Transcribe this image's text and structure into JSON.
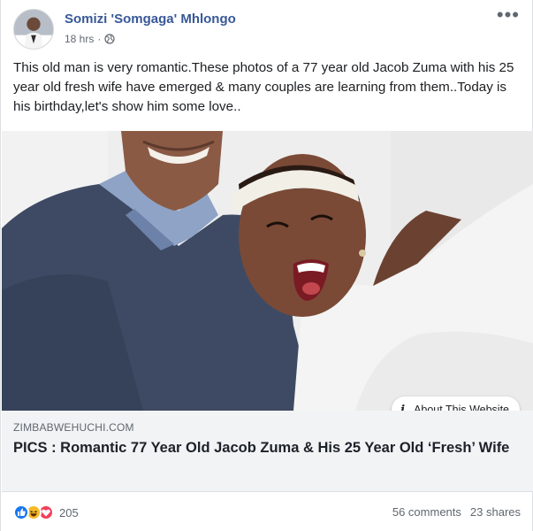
{
  "post": {
    "author": "Somizi 'Somgaga' Mhlongo",
    "time": "18 hrs",
    "separator": "·",
    "privacy_icon": "globe-icon",
    "more_icon": "more-options-icon",
    "more_glyph": "•••",
    "text": "This old man is very romantic.These photos of a 77 year old Jacob Zuma with his 25 year old fresh wife have emerged & many couples are learning from them..Today is his birthday,let's show him some love.."
  },
  "link": {
    "about_icon": "info-icon",
    "about_glyph": "i",
    "about_label": "About This Website",
    "domain": "ZIMBABWEHUCHI.COM",
    "title": "PICS : Romantic 77 Year Old Jacob Zuma & His 25 Year Old ‘Fresh’ Wife"
  },
  "footer": {
    "reaction_icons": [
      "like-icon",
      "haha-icon",
      "love-icon"
    ],
    "reaction_count": "205",
    "comments": "56 comments",
    "shares": "23 shares"
  },
  "colors": {
    "author_link": "#385898",
    "link_box_bg": "#f2f3f5",
    "like": "#1877f2",
    "haha": "#f7b928",
    "love": "#f33e58"
  }
}
